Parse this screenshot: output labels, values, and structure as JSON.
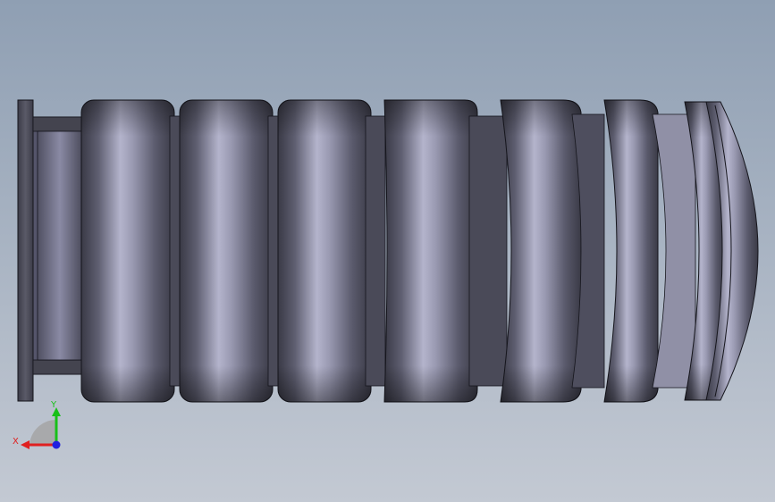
{
  "viewport": {
    "background_top": "#8f9fb3",
    "background_bottom": "#c3c9d3"
  },
  "model": {
    "segment_count": 8,
    "colors": {
      "body_dark": "#3d3d49",
      "body_mid": "#7b7b8f",
      "body_light": "#b9b9d2",
      "outline": "#15151c"
    }
  },
  "triad": {
    "x_label": "X",
    "y_label": "Y",
    "colors": {
      "x": "#e02020",
      "y": "#18c018",
      "z": "#2020e0"
    }
  }
}
